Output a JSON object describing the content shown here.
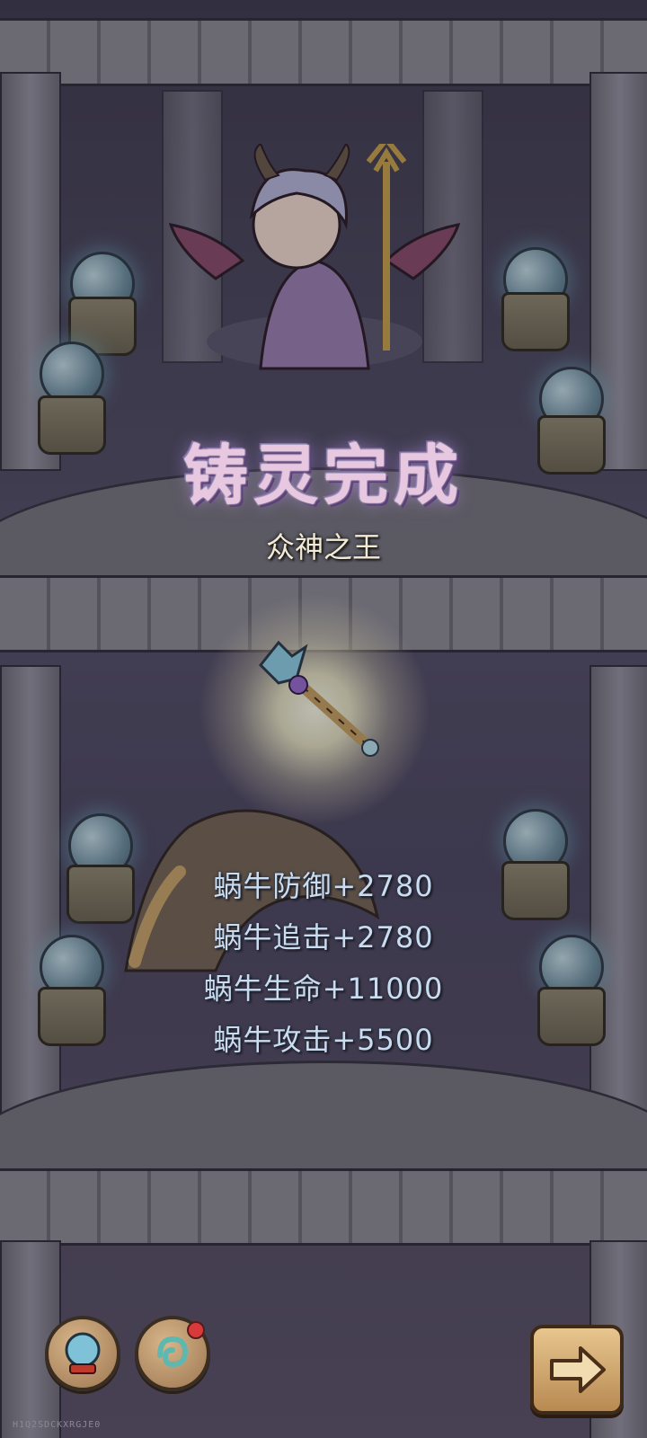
{
  "result": {
    "title": "铸灵完成",
    "subtitle": "众神之王"
  },
  "stats": [
    {
      "text": "蜗牛防御+2780"
    },
    {
      "text": "蜗牛追击+2780"
    },
    {
      "text": "蜗牛生命+11000"
    },
    {
      "text": "蜗牛攻击+5500"
    }
  ],
  "footer": {
    "build_code": "H1Q2SDCKXRGJE0"
  },
  "icons": {
    "left_button": "orb-icon",
    "middle_button": "spirit-icon",
    "next_button": "arrow-right-icon"
  },
  "colors": {
    "title": "#e8c8e0",
    "stat_text": "#c9dcf0",
    "notification": "#d83a3a"
  }
}
